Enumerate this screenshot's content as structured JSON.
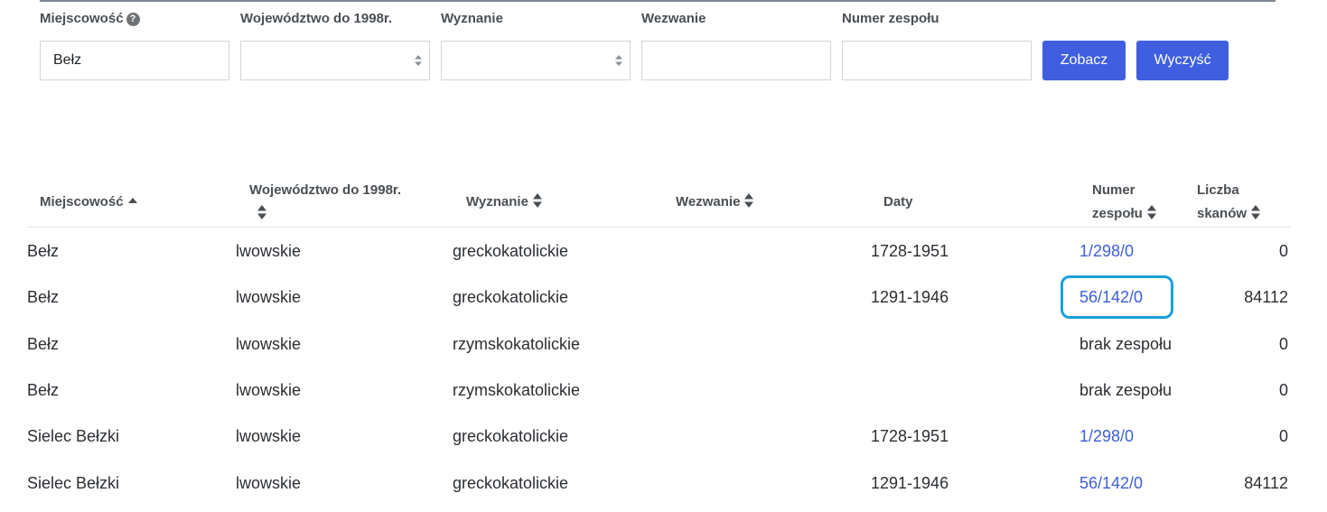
{
  "filters": {
    "miejscowosc": {
      "label": "Miejscowość",
      "value": "Bełz",
      "help_icon": "?"
    },
    "wojewodztwo": {
      "label": "Województwo do 1998r.",
      "value": ""
    },
    "wyznanie": {
      "label": "Wyznanie",
      "value": ""
    },
    "wezwanie": {
      "label": "Wezwanie",
      "value": ""
    },
    "numer_zespolu": {
      "label": "Numer zespołu",
      "value": ""
    },
    "submit_label": "Zobacz",
    "clear_label": "Wyczyść"
  },
  "table": {
    "headers": {
      "miejscowosc": "Miejscowość",
      "wojewodztwo": "Województwo do 1998r.",
      "wyznanie": "Wyznanie",
      "wezwanie": "Wezwanie",
      "daty": "Daty",
      "numer_line1": "Numer",
      "numer_line2": "zespołu",
      "liczba_line1": "Liczba",
      "liczba_line2": "skanów"
    },
    "rows": [
      {
        "miejscowosc": "Bełz",
        "wojewodztwo": "lwowskie",
        "wyznanie": "greckokatolickie",
        "wezwanie": "",
        "daty": "1728-1951",
        "numer": "1/298/0",
        "skany": "0"
      },
      {
        "miejscowosc": "Bełz",
        "wojewodztwo": "lwowskie",
        "wyznanie": "greckokatolickie",
        "wezwanie": "",
        "daty": "1291-1946",
        "numer": "56/142/0",
        "skany": "84112"
      },
      {
        "miejscowosc": "Bełz",
        "wojewodztwo": "lwowskie",
        "wyznanie": "rzymskokatolickie",
        "wezwanie": "",
        "daty": "",
        "numer": "brak zespołu",
        "skany": "0"
      },
      {
        "miejscowosc": "Bełz",
        "wojewodztwo": "lwowskie",
        "wyznanie": "rzymskokatolickie",
        "wezwanie": "",
        "daty": "",
        "numer": "brak zespołu",
        "skany": "0"
      },
      {
        "miejscowosc": "Sielec Bełzki",
        "wojewodztwo": "lwowskie",
        "wyznanie": "greckokatolickie",
        "wezwanie": "",
        "daty": "1728-1951",
        "numer": "1/298/0",
        "skany": "0"
      },
      {
        "miejscowosc": "Sielec Bełzki",
        "wojewodztwo": "lwowskie",
        "wyznanie": "greckokatolickie",
        "wezwanie": "",
        "daty": "1291-1946",
        "numer": "56/142/0",
        "skany": "84112"
      }
    ]
  },
  "colors": {
    "primary_button": "#3f5fe0",
    "link": "#3e5fd6",
    "highlight": "#1aa0dd"
  }
}
